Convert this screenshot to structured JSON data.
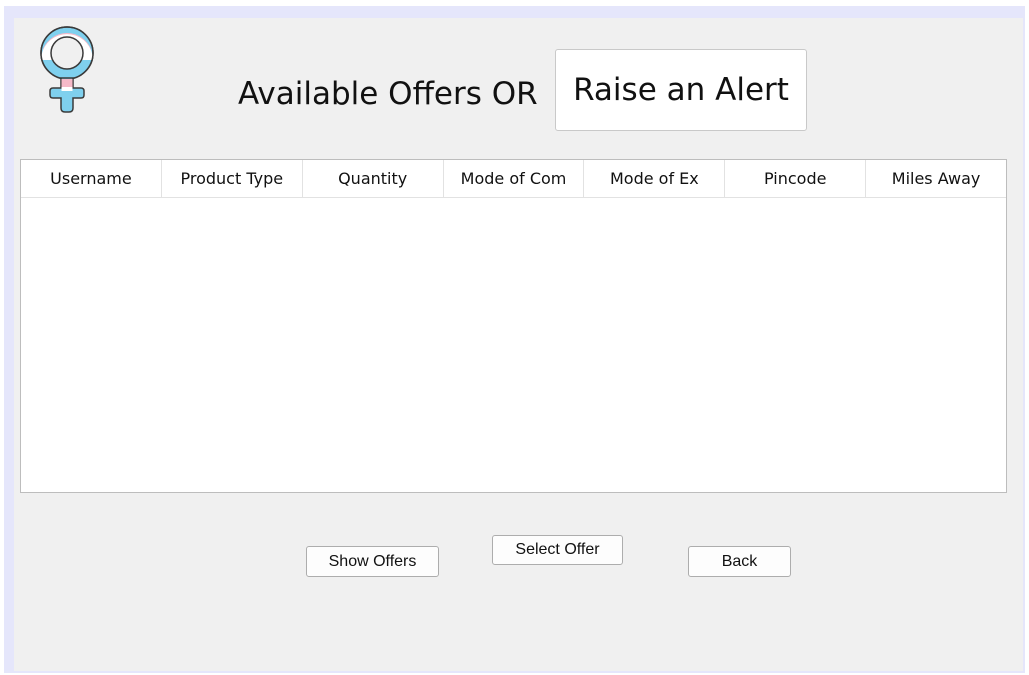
{
  "header": {
    "title": "Available Offers OR",
    "alert_button_label": "Raise an Alert",
    "logo_icon": "venus-symbol-icon"
  },
  "offers_table": {
    "columns": [
      "Username",
      "Product Type",
      "Quantity",
      "Mode of Com",
      "Mode of Ex",
      "Pincode",
      "Miles Away"
    ],
    "rows": []
  },
  "actions": {
    "show_offers_label": "Show Offers",
    "select_offer_label": "Select Offer",
    "back_label": "Back"
  },
  "colors": {
    "window_background": "#f0f0f0",
    "frame_border": "#e5e6fb",
    "logo_blue": "#7fd0ee",
    "logo_pink": "#f5b9c8"
  }
}
